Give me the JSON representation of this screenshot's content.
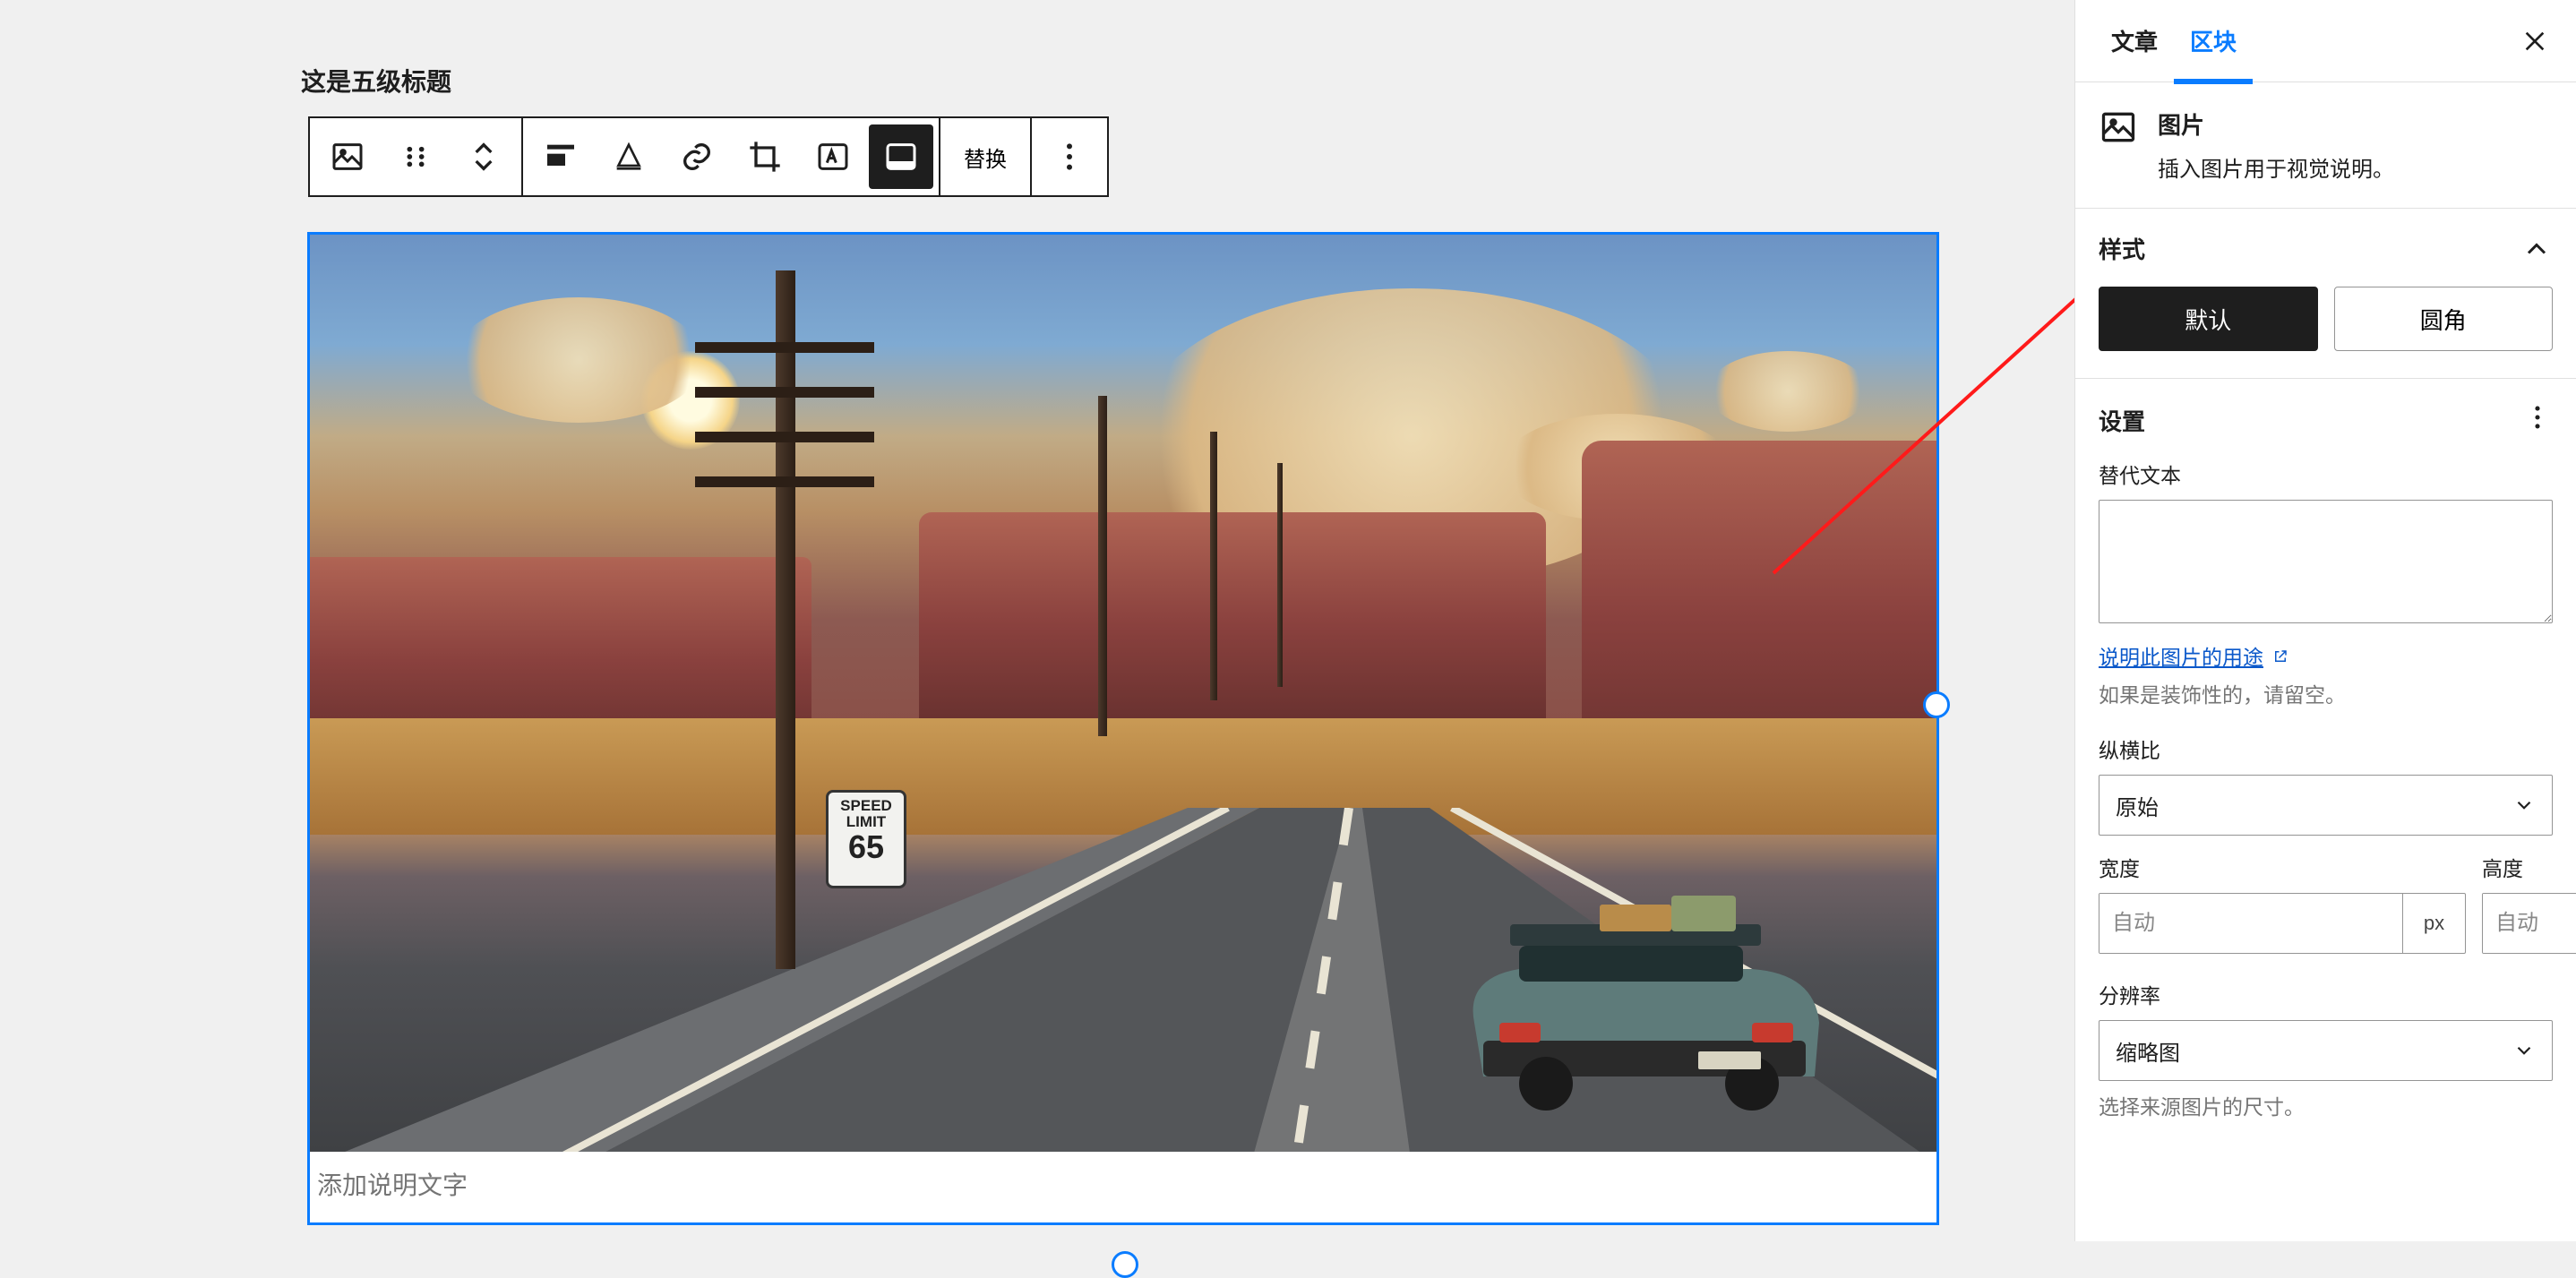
{
  "editor": {
    "heading_text": "这是五级标题",
    "caption_placeholder": "添加说明文字",
    "sign": {
      "line1": "SPEED",
      "line2": "LIMIT",
      "number": "65"
    }
  },
  "toolbar": {
    "replace_label": "替换"
  },
  "sidebar": {
    "tabs": {
      "post": "文章",
      "block": "区块"
    },
    "block_info": {
      "title": "图片",
      "description": "插入图片用于视觉说明。"
    },
    "styles": {
      "heading": "样式",
      "default_label": "默认",
      "rounded_label": "圆角"
    },
    "settings": {
      "heading": "设置"
    },
    "alt": {
      "label": "替代文本",
      "value": "",
      "link_text": "说明此图片的用途",
      "hint": "如果是装饰性的，请留空。"
    },
    "aspect": {
      "label": "纵横比",
      "value": "原始"
    },
    "dimensions": {
      "width_label": "宽度",
      "height_label": "高度",
      "width_placeholder": "自动",
      "height_placeholder": "自动",
      "unit": "px"
    },
    "resolution": {
      "label": "分辨率",
      "value": "缩略图",
      "hint": "选择来源图片的尺寸。"
    }
  }
}
